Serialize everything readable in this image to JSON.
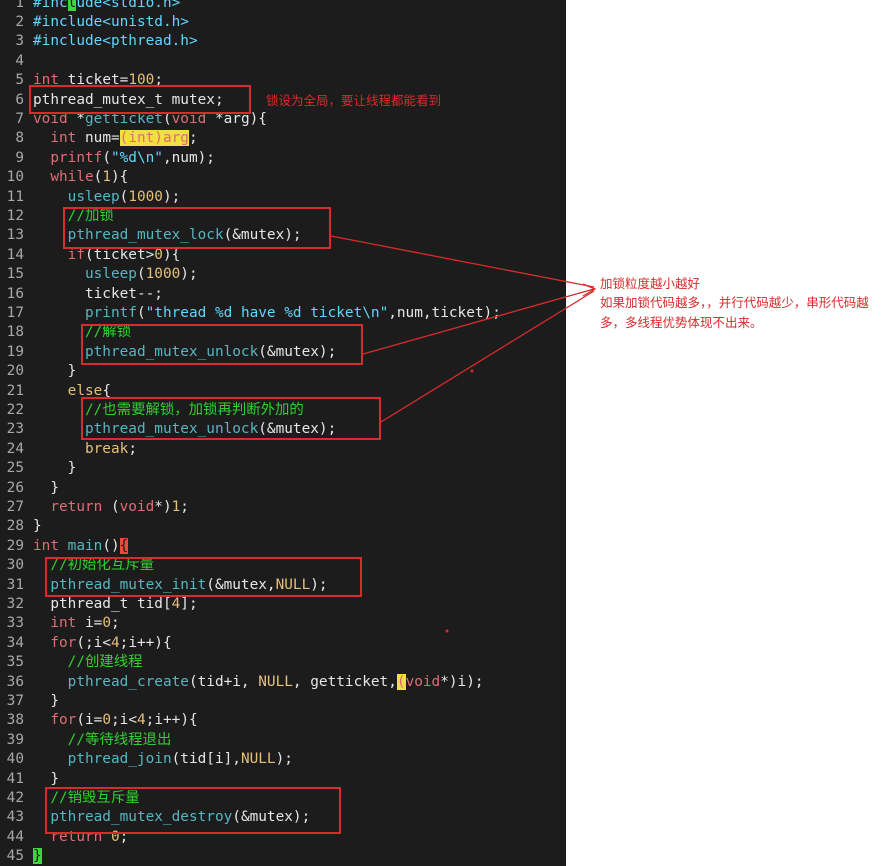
{
  "lines": [
    {
      "n": "1",
      "segs": [
        {
          "t": "#inc",
          "c": "s"
        },
        {
          "t": "l",
          "c": "cur"
        },
        {
          "t": "ude<stdio.h>",
          "c": "s"
        }
      ]
    },
    {
      "n": "2",
      "segs": [
        {
          "t": "#include<unistd.h>",
          "c": "s"
        }
      ]
    },
    {
      "n": "3",
      "segs": [
        {
          "t": "#include<pthread.h>",
          "c": "s"
        }
      ]
    },
    {
      "n": "4",
      "segs": []
    },
    {
      "n": "5",
      "segs": [
        {
          "t": "int",
          "c": "k"
        },
        {
          "t": " ticket=",
          "c": "t"
        },
        {
          "t": "100",
          "c": "n"
        },
        {
          "t": ";",
          "c": "t"
        }
      ]
    },
    {
      "n": "6",
      "segs": [
        {
          "t": "pthread_mutex_t mutex;",
          "c": "t"
        }
      ]
    },
    {
      "n": "7",
      "segs": [
        {
          "t": "void",
          "c": "k"
        },
        {
          "t": " *",
          "c": "t"
        },
        {
          "t": "getticket",
          "c": "f"
        },
        {
          "t": "(",
          "c": "t"
        },
        {
          "t": "void",
          "c": "k"
        },
        {
          "t": " *arg){",
          "c": "t"
        }
      ]
    },
    {
      "n": "8",
      "segs": [
        {
          "t": "  ",
          "c": "t"
        },
        {
          "t": "int",
          "c": "k"
        },
        {
          "t": " num=",
          "c": "t"
        },
        {
          "t": "(int)arg",
          "c": "hl"
        },
        {
          "t": ";",
          "c": "t"
        }
      ]
    },
    {
      "n": "9",
      "segs": [
        {
          "t": "  ",
          "c": "t"
        },
        {
          "t": "printf",
          "c": "k"
        },
        {
          "t": "(",
          "c": "t"
        },
        {
          "t": "\"%d\\n\"",
          "c": "s"
        },
        {
          "t": ",num);",
          "c": "t"
        }
      ]
    },
    {
      "n": "10",
      "segs": [
        {
          "t": "  ",
          "c": "t"
        },
        {
          "t": "while",
          "c": "k"
        },
        {
          "t": "(",
          "c": "t"
        },
        {
          "t": "1",
          "c": "n"
        },
        {
          "t": "){",
          "c": "t"
        }
      ]
    },
    {
      "n": "11",
      "segs": [
        {
          "t": "    ",
          "c": "t"
        },
        {
          "t": "usleep",
          "c": "f"
        },
        {
          "t": "(",
          "c": "t"
        },
        {
          "t": "1000",
          "c": "n"
        },
        {
          "t": ");",
          "c": "t"
        }
      ]
    },
    {
      "n": "12",
      "segs": [
        {
          "t": "    ",
          "c": "t"
        },
        {
          "t": "//加锁",
          "c": "c"
        }
      ]
    },
    {
      "n": "13",
      "segs": [
        {
          "t": "    ",
          "c": "t"
        },
        {
          "t": "pthread_mutex_lock",
          "c": "f"
        },
        {
          "t": "(&mutex);",
          "c": "t"
        }
      ]
    },
    {
      "n": "14",
      "segs": [
        {
          "t": "    ",
          "c": "t"
        },
        {
          "t": "if",
          "c": "k"
        },
        {
          "t": "(ticket>",
          "c": "t"
        },
        {
          "t": "0",
          "c": "n"
        },
        {
          "t": "){",
          "c": "t"
        }
      ]
    },
    {
      "n": "15",
      "segs": [
        {
          "t": "      ",
          "c": "t"
        },
        {
          "t": "usleep",
          "c": "f"
        },
        {
          "t": "(",
          "c": "t"
        },
        {
          "t": "1000",
          "c": "n"
        },
        {
          "t": ");",
          "c": "t"
        }
      ]
    },
    {
      "n": "16",
      "segs": [
        {
          "t": "      ticket--;",
          "c": "t"
        }
      ]
    },
    {
      "n": "17",
      "segs": [
        {
          "t": "      ",
          "c": "t"
        },
        {
          "t": "printf",
          "c": "f"
        },
        {
          "t": "(",
          "c": "t"
        },
        {
          "t": "\"thread %d have %d ticket\\n\"",
          "c": "s"
        },
        {
          "t": ",num,ticket);",
          "c": "t"
        }
      ]
    },
    {
      "n": "18",
      "segs": [
        {
          "t": "      ",
          "c": "t"
        },
        {
          "t": "//解锁",
          "c": "c"
        }
      ]
    },
    {
      "n": "19",
      "segs": [
        {
          "t": "      ",
          "c": "t"
        },
        {
          "t": "pthread_mutex_unlock",
          "c": "f"
        },
        {
          "t": "(&mutex);",
          "c": "t"
        }
      ]
    },
    {
      "n": "20",
      "segs": [
        {
          "t": "    }",
          "c": "t"
        }
      ]
    },
    {
      "n": "21",
      "segs": [
        {
          "t": "    ",
          "c": "t"
        },
        {
          "t": "else",
          "c": "n"
        },
        {
          "t": "{",
          "c": "t"
        }
      ]
    },
    {
      "n": "22",
      "segs": [
        {
          "t": "      ",
          "c": "t"
        },
        {
          "t": "//也需要解锁，加锁再判断外加的",
          "c": "c"
        }
      ]
    },
    {
      "n": "23",
      "segs": [
        {
          "t": "      ",
          "c": "t"
        },
        {
          "t": "pthread_mutex_unlock",
          "c": "f"
        },
        {
          "t": "(&mutex);",
          "c": "t"
        }
      ]
    },
    {
      "n": "24",
      "segs": [
        {
          "t": "      ",
          "c": "t"
        },
        {
          "t": "break",
          "c": "n"
        },
        {
          "t": ";",
          "c": "t"
        }
      ]
    },
    {
      "n": "25",
      "segs": [
        {
          "t": "    }",
          "c": "t"
        }
      ]
    },
    {
      "n": "26",
      "segs": [
        {
          "t": "  }",
          "c": "t"
        }
      ]
    },
    {
      "n": "27",
      "segs": [
        {
          "t": "  ",
          "c": "t"
        },
        {
          "t": "return",
          "c": "k"
        },
        {
          "t": " (",
          "c": "t"
        },
        {
          "t": "void",
          "c": "k"
        },
        {
          "t": "*)",
          "c": "t"
        },
        {
          "t": "1",
          "c": "n"
        },
        {
          "t": ";",
          "c": "t"
        }
      ]
    },
    {
      "n": "28",
      "segs": [
        {
          "t": "}",
          "c": "t"
        }
      ]
    },
    {
      "n": "29",
      "segs": [
        {
          "t": "int",
          "c": "k"
        },
        {
          "t": " ",
          "c": "t"
        },
        {
          "t": "main",
          "c": "f"
        },
        {
          "t": "()",
          "c": "t"
        },
        {
          "t": "{",
          "c": "curR"
        }
      ]
    },
    {
      "n": "30",
      "segs": [
        {
          "t": "  ",
          "c": "t"
        },
        {
          "t": "//初始化互斥量",
          "c": "c"
        }
      ]
    },
    {
      "n": "31",
      "segs": [
        {
          "t": "  ",
          "c": "t"
        },
        {
          "t": "pthread_mutex_init",
          "c": "f"
        },
        {
          "t": "(&mutex,",
          "c": "t"
        },
        {
          "t": "NULL",
          "c": "n"
        },
        {
          "t": ");",
          "c": "t"
        }
      ]
    },
    {
      "n": "32",
      "segs": [
        {
          "t": "  pthread_t tid[",
          "c": "t"
        },
        {
          "t": "4",
          "c": "n"
        },
        {
          "t": "];",
          "c": "t"
        }
      ]
    },
    {
      "n": "33",
      "segs": [
        {
          "t": "  ",
          "c": "t"
        },
        {
          "t": "int",
          "c": "k"
        },
        {
          "t": " i=",
          "c": "t"
        },
        {
          "t": "0",
          "c": "n"
        },
        {
          "t": ";",
          "c": "t"
        }
      ]
    },
    {
      "n": "34",
      "segs": [
        {
          "t": "  ",
          "c": "t"
        },
        {
          "t": "for",
          "c": "k"
        },
        {
          "t": "(;i<",
          "c": "t"
        },
        {
          "t": "4",
          "c": "n"
        },
        {
          "t": ";i++){",
          "c": "t"
        }
      ]
    },
    {
      "n": "35",
      "segs": [
        {
          "t": "    ",
          "c": "t"
        },
        {
          "t": "//创建线程",
          "c": "c"
        }
      ]
    },
    {
      "n": "36",
      "segs": [
        {
          "t": "    ",
          "c": "t"
        },
        {
          "t": "pthread_create",
          "c": "f"
        },
        {
          "t": "(tid+i, ",
          "c": "t"
        },
        {
          "t": "NULL",
          "c": "n"
        },
        {
          "t": ", getticket,",
          "c": "t"
        },
        {
          "t": "(",
          "c": "hl"
        },
        {
          "t": "void",
          "c": "k"
        },
        {
          "t": "*)i);",
          "c": "t"
        }
      ]
    },
    {
      "n": "37",
      "segs": [
        {
          "t": "  }",
          "c": "t"
        }
      ]
    },
    {
      "n": "38",
      "segs": [
        {
          "t": "  ",
          "c": "t"
        },
        {
          "t": "for",
          "c": "k"
        },
        {
          "t": "(i=",
          "c": "t"
        },
        {
          "t": "0",
          "c": "n"
        },
        {
          "t": ";i<",
          "c": "t"
        },
        {
          "t": "4",
          "c": "n"
        },
        {
          "t": ";i++){",
          "c": "t"
        }
      ]
    },
    {
      "n": "39",
      "segs": [
        {
          "t": "    ",
          "c": "t"
        },
        {
          "t": "//等待线程退出",
          "c": "c"
        }
      ]
    },
    {
      "n": "40",
      "segs": [
        {
          "t": "    ",
          "c": "t"
        },
        {
          "t": "pthread_join",
          "c": "f"
        },
        {
          "t": "(tid[i],",
          "c": "t"
        },
        {
          "t": "NULL",
          "c": "n"
        },
        {
          "t": ");",
          "c": "t"
        }
      ]
    },
    {
      "n": "41",
      "segs": [
        {
          "t": "  }",
          "c": "t"
        }
      ]
    },
    {
      "n": "42",
      "segs": [
        {
          "t": "  ",
          "c": "t"
        },
        {
          "t": "//销毁互斥量",
          "c": "c"
        }
      ]
    },
    {
      "n": "43",
      "segs": [
        {
          "t": "  ",
          "c": "t"
        },
        {
          "t": "pthread_mutex_destroy",
          "c": "f"
        },
        {
          "t": "(&mutex);",
          "c": "t"
        }
      ]
    },
    {
      "n": "44",
      "segs": [
        {
          "t": "  ",
          "c": "t"
        },
        {
          "t": "return",
          "c": "k"
        },
        {
          "t": " ",
          "c": "t"
        },
        {
          "t": "0",
          "c": "n"
        },
        {
          "t": ";",
          "c": "t"
        }
      ]
    },
    {
      "n": "45",
      "segs": [
        {
          "t": "}",
          "c": "cur"
        }
      ]
    }
  ],
  "annotations": {
    "global_note": "锁设为全局，要让线程都能看到",
    "granularity_title": "加锁粒度越小越好",
    "granularity_body": "如果加锁代码越多，，并行代码越少，串形代码越多，多线程优势体现不出来。"
  },
  "colors": {
    "editor_bg": "#1c1c1c",
    "keyword": "#e06c75",
    "number": "#e5c07b",
    "string": "#5fd7ff",
    "function": "#56b6c2",
    "comment": "#2fd02f",
    "annotation_red": "#d92b2b"
  }
}
